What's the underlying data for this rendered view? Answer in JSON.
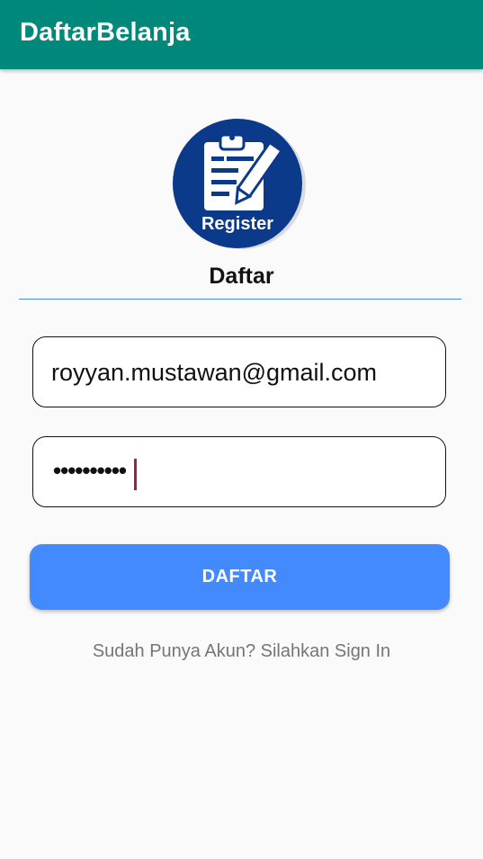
{
  "app_bar": {
    "title": "DaftarBelanja",
    "color": "#00897b"
  },
  "logo": {
    "icon": "register-clipboard-icon",
    "label": "Register"
  },
  "form": {
    "heading": "Daftar",
    "email_value": "royyan.mustawan@gmail.com",
    "password_mask": "••••••••••",
    "submit_label": "DAFTAR",
    "submit_color": "#448aff"
  },
  "footer": {
    "signin_text": "Sudah Punya Akun? Silahkan Sign In"
  }
}
